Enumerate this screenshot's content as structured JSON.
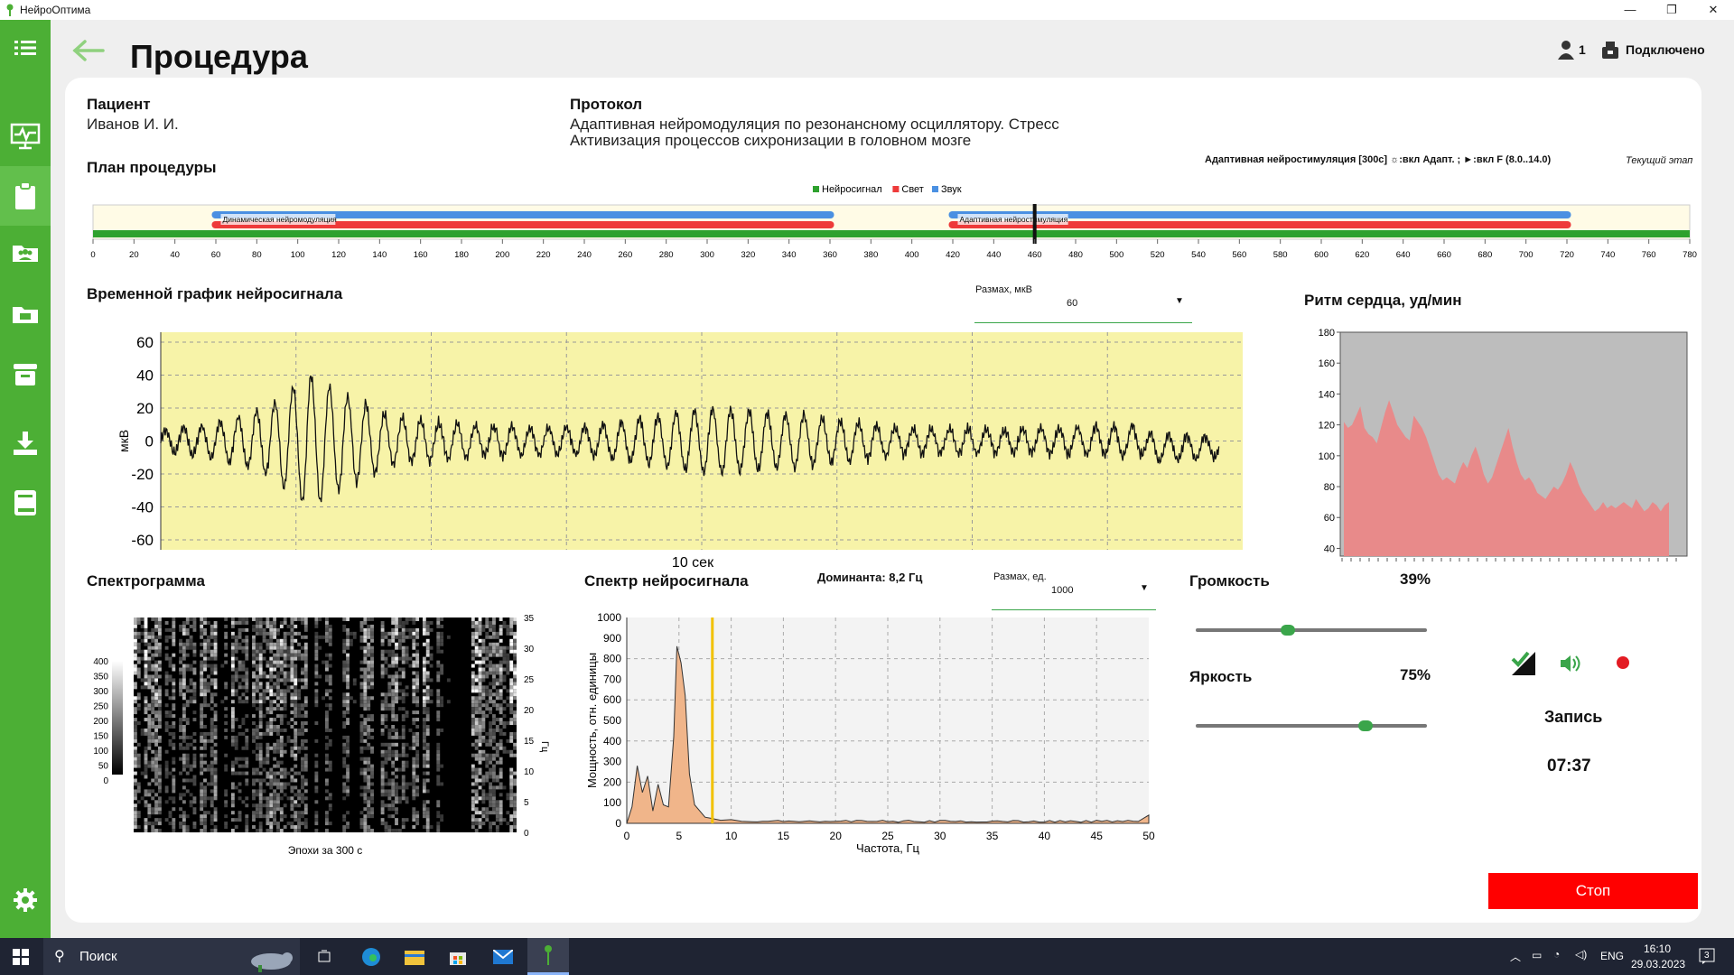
{
  "app": {
    "title": "НейроОптима",
    "connection": "Подключено",
    "user_count": "1"
  },
  "page": {
    "title": "Процедура"
  },
  "patient": {
    "label": "Пациент",
    "name": "Иванов И. И."
  },
  "protocol": {
    "label": "Протокол",
    "line1": "Адаптивная нейромодуляция по резонансному осциллятору. Стресс",
    "line2": "Активизация процессов сихронизации в головном мозге"
  },
  "plan": {
    "label": "План процедуры",
    "stage_info": "Адаптивная нейростимуляция [300с] ☼:вкл Адапт. ; ►:вкл F (8.0..14.0)",
    "current_stage": "Текущий этап",
    "legend": [
      {
        "name": "Нейросигнал",
        "color": "#2ea12e"
      },
      {
        "name": "Свет",
        "color": "#ee3a3a"
      },
      {
        "name": "Звук",
        "color": "#4a90e2"
      }
    ],
    "segments": [
      {
        "label": "Динамическая нейромодуляция",
        "start": 58,
        "end": 362
      },
      {
        "label": "Адаптивная нейростимуляция",
        "start": 418,
        "end": 722
      }
    ],
    "cursor": 460,
    "axis_max": 780,
    "ticks": [
      "0",
      "20",
      "40",
      "60",
      "80",
      "100",
      "120",
      "140",
      "160",
      "180",
      "200",
      "220",
      "240",
      "260",
      "280",
      "300",
      "320",
      "340",
      "360",
      "380",
      "400",
      "420",
      "440",
      "460",
      "480",
      "500",
      "520",
      "540",
      "560",
      "580",
      "600",
      "620",
      "640",
      "660",
      "680",
      "700",
      "720",
      "740",
      "760",
      "780"
    ]
  },
  "timeseries": {
    "label": "Временной график нейросигнала",
    "range_label": "Размах, мкВ",
    "range_value": "60",
    "ylabel": "мкВ",
    "xlabel": "10 сек",
    "yticks": [
      "60",
      "40",
      "20",
      "0",
      "-20",
      "-40",
      "-60"
    ]
  },
  "heart": {
    "label": "Ритм сердца, уд/мин",
    "yticks": [
      "180",
      "160",
      "140",
      "120",
      "100",
      "80",
      "60",
      "40"
    ],
    "values": [
      122,
      118,
      120,
      126,
      132,
      118,
      114,
      112,
      108,
      118,
      128,
      136,
      128,
      120,
      116,
      112,
      110,
      126,
      122,
      118,
      112,
      104,
      96,
      88,
      84,
      86,
      84,
      82,
      90,
      96,
      92,
      100,
      106,
      98,
      88,
      82,
      86,
      94,
      102,
      110,
      118,
      106,
      96,
      88,
      84,
      86,
      82,
      76,
      74,
      72,
      76,
      80,
      78,
      82,
      88,
      96,
      90,
      82,
      76,
      72,
      68,
      64,
      66,
      70,
      66,
      68,
      66,
      68,
      70,
      68,
      66,
      72,
      68,
      64,
      66,
      70,
      68,
      64,
      68,
      70
    ]
  },
  "spectrogram": {
    "label": "Спектрограмма",
    "xlabel": "Эпохи за 300 с",
    "ylabel": "Гц",
    "yticks": [
      "35",
      "30",
      "25",
      "20",
      "15",
      "10",
      "5",
      "0"
    ],
    "cbar": [
      "400",
      "350",
      "300",
      "250",
      "200",
      "150",
      "100",
      "50",
      "0"
    ]
  },
  "spectrum": {
    "label": "Спектр нейросигнала",
    "dominant": "Доминанта: 8,2 Гц",
    "range_label": "Размах, ед.",
    "range_value": "1000",
    "ylabel": "Мощность, отн. единицы",
    "xlabel": "Частота, Гц",
    "yticks": [
      "1000",
      "900",
      "800",
      "700",
      "600",
      "500",
      "400",
      "300",
      "200",
      "100",
      "0"
    ],
    "xticks": [
      "0",
      "5",
      "10",
      "15",
      "20",
      "25",
      "30",
      "35",
      "40",
      "45",
      "50"
    ],
    "dominant_freq": 8.2
  },
  "controls": {
    "volume_label": "Громкость",
    "volume_value": "39%",
    "volume": 0.39,
    "brightness_label": "Яркость",
    "brightness_value": "75%",
    "brightness": 0.75,
    "record_label": "Запись",
    "timer": "07:37",
    "stop_label": "Стоп"
  },
  "taskbar": {
    "search": "Поиск",
    "lang": "ENG",
    "time": "16:10",
    "date": "29.03.2023",
    "notif": "3"
  }
}
